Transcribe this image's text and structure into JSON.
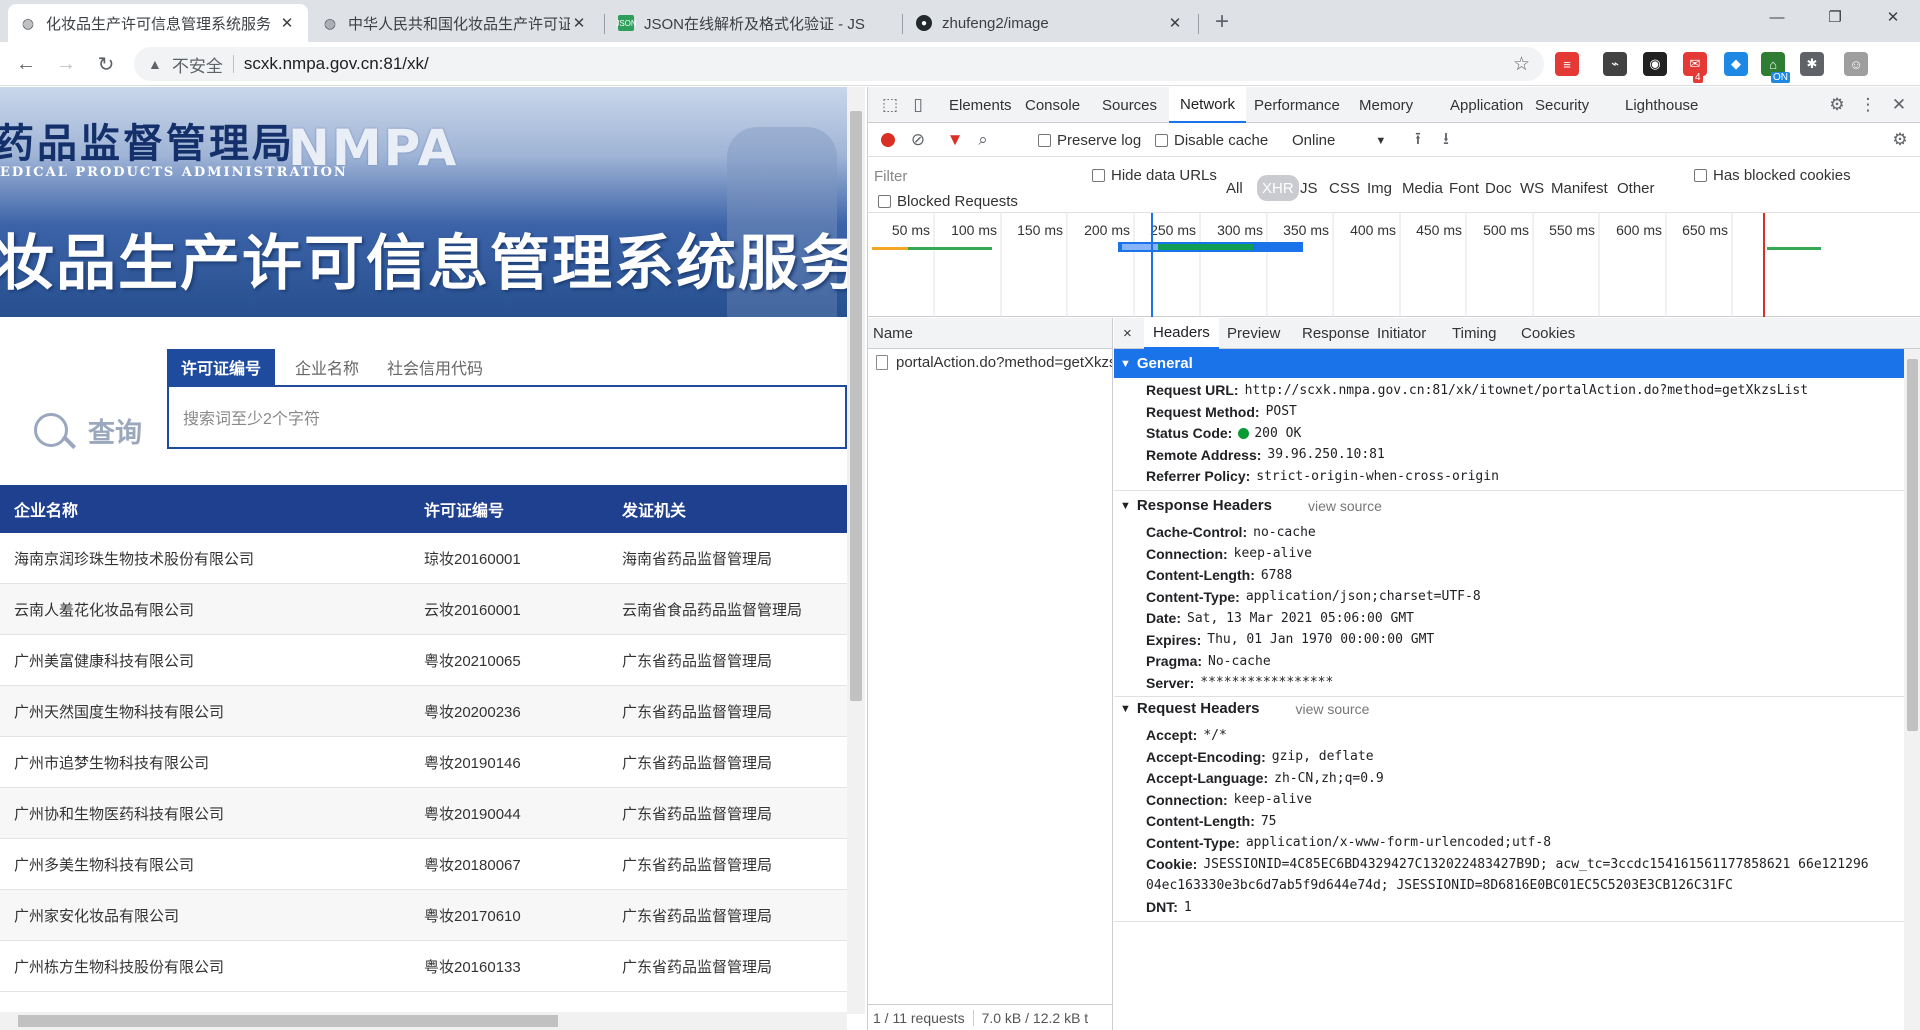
{
  "browser": {
    "tabs": [
      {
        "title": "化妆品生产许可信息管理系统服务",
        "icon": "globe-icon",
        "active": true
      },
      {
        "title": "中华人民共和国化妆品生产许可证",
        "icon": "globe-icon",
        "active": false
      },
      {
        "title": "JSON在线解析及格式化验证 - JS",
        "icon": "json-icon",
        "active": false
      },
      {
        "title": "zhufeng2/image",
        "icon": "github-icon",
        "active": false
      }
    ],
    "new_tab": "+",
    "address": {
      "insecure_label": "不安全",
      "url": "scxk.nmpa.gov.cn:81/xk/"
    },
    "extensions": [
      {
        "name": "ext-red",
        "color": "#e53935",
        "glyph": "≡"
      },
      {
        "name": "ext-chart",
        "color": "#424242",
        "glyph": "⌁"
      },
      {
        "name": "ext-cat",
        "color": "#212121",
        "glyph": "◉"
      },
      {
        "name": "ext-mail",
        "color": "#e53935",
        "glyph": "✉",
        "badge": "4"
      },
      {
        "name": "ext-diamond",
        "color": "#1e88e5",
        "glyph": "◆"
      },
      {
        "name": "ext-on",
        "color": "#2e7d32",
        "glyph": "⌂",
        "badge": "ON"
      },
      {
        "name": "ext-puzzle",
        "color": "#5f6368",
        "glyph": "✱"
      },
      {
        "name": "ext-profile",
        "color": "#9e9e9e",
        "glyph": "☺"
      }
    ]
  },
  "site": {
    "bureau_name": "药品监督管理局",
    "english_name": "EDICAL PRODUCTS ADMINISTRATION",
    "logo_text": "NMPA",
    "system_title": "妆品生产许可信息管理系统服务平",
    "search_tabs": [
      "许可证编号",
      "企业名称",
      "社会信用代码"
    ],
    "search_logo_text": "查询",
    "search_placeholder": "搜索词至少2个字符",
    "table": {
      "headers": [
        "企业名称",
        "许可证编号",
        "发证机关"
      ],
      "rows": [
        [
          "海南京润珍珠生物技术股份有限公司",
          "琼妆20160001",
          "海南省药品监督管理局"
        ],
        [
          "云南人羞花化妆品有限公司",
          "云妆20160001",
          "云南省食品药品监督管理局"
        ],
        [
          "广州美富健康科技有限公司",
          "粤妆20210065",
          "广东省药品监督管理局"
        ],
        [
          "广州天然国度生物科技有限公司",
          "粤妆20200236",
          "广东省药品监督管理局"
        ],
        [
          "广州市追梦生物科技有限公司",
          "粤妆20190146",
          "广东省药品监督管理局"
        ],
        [
          "广州协和生物医药科技有限公司",
          "粤妆20190044",
          "广东省药品监督管理局"
        ],
        [
          "广州多美生物科技有限公司",
          "粤妆20180067",
          "广东省药品监督管理局"
        ],
        [
          "广州家安化妆品有限公司",
          "粤妆20170610",
          "广东省药品监督管理局"
        ],
        [
          "广州栋方生物科技股份有限公司",
          "粤妆20160133",
          "广东省药品监督管理局"
        ]
      ]
    }
  },
  "devtools": {
    "panels": [
      "Elements",
      "Console",
      "Sources",
      "Network",
      "Performance",
      "Memory",
      "Application",
      "Security",
      "Lighthouse"
    ],
    "active_panel": "Network",
    "toolbar": {
      "preserve_log": "Preserve log",
      "disable_cache": "Disable cache",
      "throttle": "Online"
    },
    "filter_placeholder": "Filter",
    "hide_data_urls": "Hide data URLs",
    "types": [
      "All",
      "XHR",
      "JS",
      "CSS",
      "Img",
      "Media",
      "Font",
      "Doc",
      "WS",
      "Manifest",
      "Other"
    ],
    "active_type": "XHR",
    "has_blocked_cookies": "Has blocked cookies",
    "blocked_requests": "Blocked Requests",
    "timeline_ticks": [
      "50 ms",
      "100 ms",
      "150 ms",
      "200 ms",
      "250 ms",
      "300 ms",
      "350 ms",
      "400 ms",
      "450 ms",
      "500 ms",
      "550 ms",
      "600 ms",
      "650 ms"
    ],
    "name_header": "Name",
    "request_name": "portalAction.do?method=getXkzsList",
    "footer": {
      "requests": "1 / 11 requests",
      "transferred": "7.0 kB / 12.2 kB t"
    },
    "detail_tabs": [
      "Headers",
      "Preview",
      "Response",
      "Initiator",
      "Timing",
      "Cookies"
    ],
    "active_detail_tab": "Headers",
    "close": "×",
    "general": {
      "title": "General",
      "fields": [
        {
          "k": "Request URL:",
          "v": "http://scxk.nmpa.gov.cn:81/xk/itownet/portalAction.do?method=getXkzsList"
        },
        {
          "k": "Request Method:",
          "v": "POST"
        },
        {
          "k": "Status Code:",
          "v": "200 OK",
          "status_color": "#0a9a33"
        },
        {
          "k": "Remote Address:",
          "v": "39.96.250.10:81"
        },
        {
          "k": "Referrer Policy:",
          "v": "strict-origin-when-cross-origin"
        }
      ]
    },
    "response_headers": {
      "title": "Response Headers",
      "view_source": "view source",
      "fields": [
        {
          "k": "Cache-Control:",
          "v": "no-cache"
        },
        {
          "k": "Connection:",
          "v": "keep-alive"
        },
        {
          "k": "Content-Length:",
          "v": "6788"
        },
        {
          "k": "Content-Type:",
          "v": "application/json;charset=UTF-8"
        },
        {
          "k": "Date:",
          "v": "Sat, 13 Mar 2021 05:06:00 GMT"
        },
        {
          "k": "Expires:",
          "v": "Thu, 01 Jan 1970 00:00:00 GMT"
        },
        {
          "k": "Pragma:",
          "v": "No-cache"
        },
        {
          "k": "Server:",
          "v": "*****************"
        }
      ]
    },
    "request_headers": {
      "title": "Request Headers",
      "view_source": "view source",
      "fields": [
        {
          "k": "Accept:",
          "v": "*/*"
        },
        {
          "k": "Accept-Encoding:",
          "v": "gzip, deflate"
        },
        {
          "k": "Accept-Language:",
          "v": "zh-CN,zh;q=0.9"
        },
        {
          "k": "Connection:",
          "v": "keep-alive"
        },
        {
          "k": "Content-Length:",
          "v": "75"
        },
        {
          "k": "Content-Type:",
          "v": "application/x-www-form-urlencoded;utf-8"
        },
        {
          "k": "Cookie:",
          "v": "JSESSIONID=4C85EC6BD4329427C132022483427B9D; acw_tc=3ccdc154161561177858621 66e121296"
        },
        {
          "k": "",
          "v": "04ec163330e3bc6d7ab5f9d644e74d; JSESSIONID=8D6816E0BC01EC5C5203E3CB126C31FC"
        },
        {
          "k": "DNT:",
          "v": "1"
        }
      ]
    }
  }
}
